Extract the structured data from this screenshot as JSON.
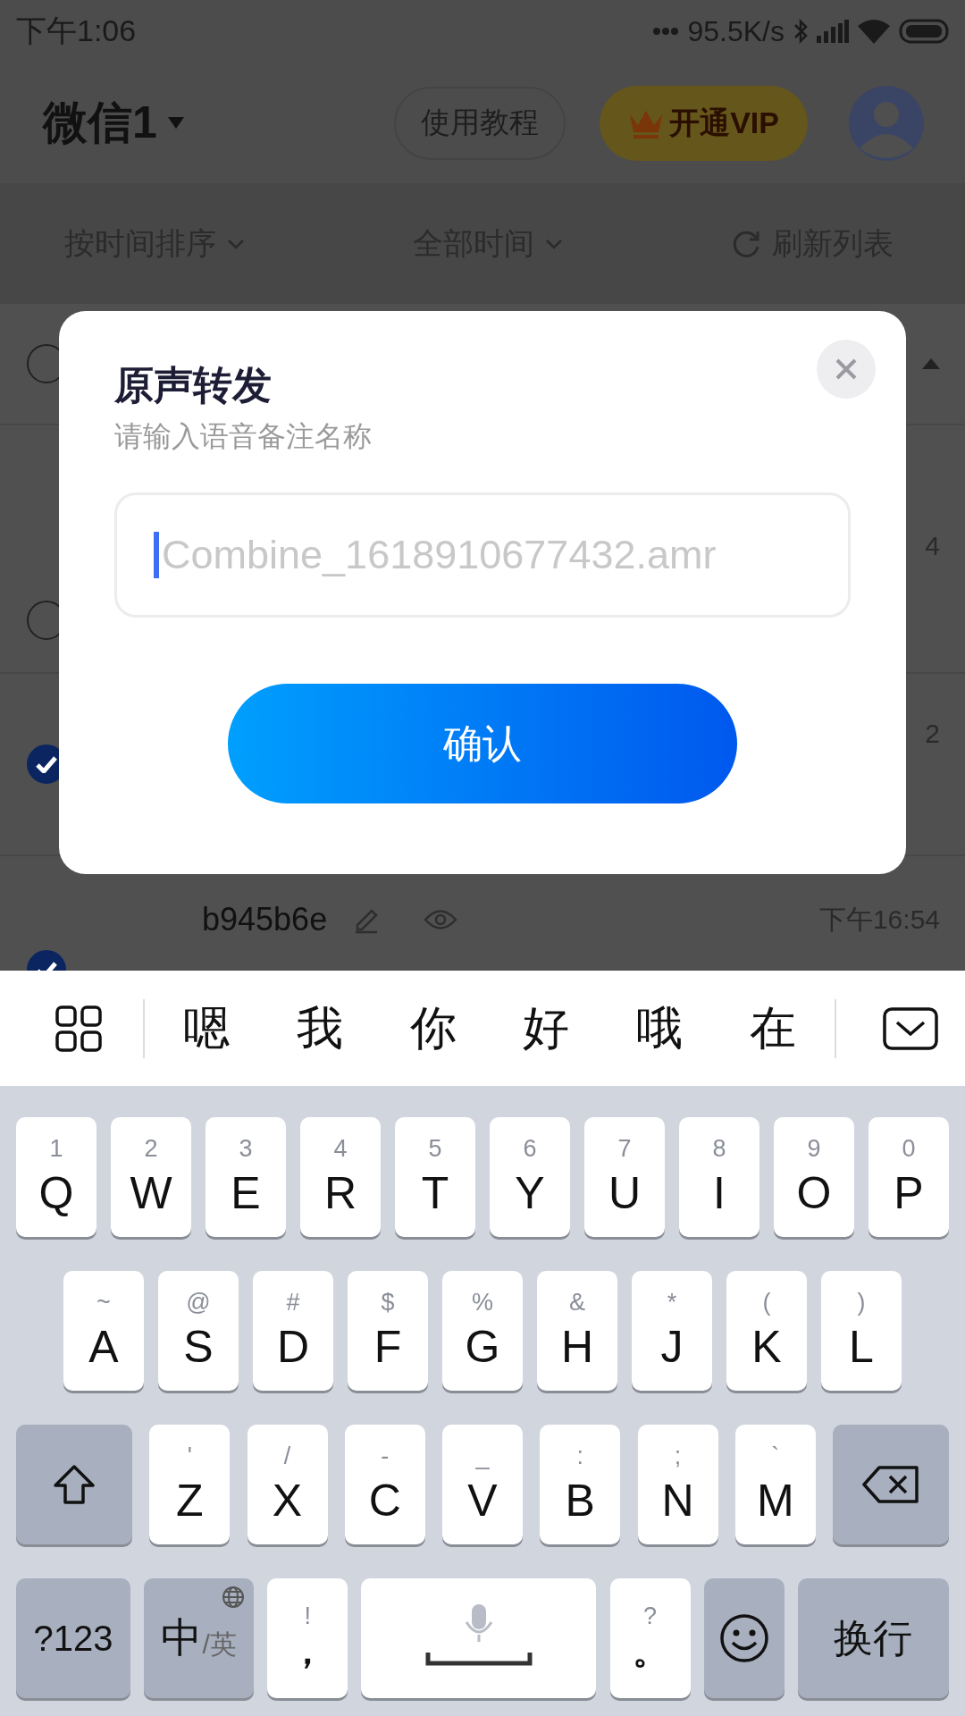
{
  "status_bar": {
    "time": "下午1:06",
    "network_speed": "95.5K/s"
  },
  "header": {
    "account": "微信1",
    "tutorial_button": "使用教程",
    "vip_button": "开通VIP"
  },
  "filters": [
    {
      "label": "按时间排序",
      "kind": "dropdown"
    },
    {
      "label": "全部时间",
      "kind": "dropdown"
    },
    {
      "label": "刷新列表",
      "kind": "refresh"
    }
  ],
  "list": [
    {
      "checked": false,
      "expanded": true
    },
    {
      "checked": false,
      "time": "4"
    },
    {
      "checked": true,
      "time": "2"
    },
    {
      "checked": true,
      "name": "b945b6e",
      "time": "下午16:54"
    }
  ],
  "dialog": {
    "title": "原声转发",
    "subtitle": "请输入语音备注名称",
    "input_placeholder": "Combine_1618910677432.amr",
    "confirm_button": "确认"
  },
  "candidates": [
    "嗯",
    "我",
    "你",
    "好",
    "哦",
    "在"
  ],
  "keyboard": [
    [
      {
        "kind": "letter",
        "label": "Q",
        "hint": "1"
      },
      {
        "kind": "letter",
        "label": "W",
        "hint": "2"
      },
      {
        "kind": "letter",
        "label": "E",
        "hint": "3"
      },
      {
        "kind": "letter",
        "label": "R",
        "hint": "4"
      },
      {
        "kind": "letter",
        "label": "T",
        "hint": "5"
      },
      {
        "kind": "letter",
        "label": "Y",
        "hint": "6"
      },
      {
        "kind": "letter",
        "label": "U",
        "hint": "7"
      },
      {
        "kind": "letter",
        "label": "I",
        "hint": "8"
      },
      {
        "kind": "letter",
        "label": "O",
        "hint": "9"
      },
      {
        "kind": "letter",
        "label": "P",
        "hint": "0"
      }
    ],
    [
      {
        "kind": "letter",
        "label": "A",
        "hint": "~"
      },
      {
        "kind": "letter",
        "label": "S",
        "hint": "@"
      },
      {
        "kind": "letter",
        "label": "D",
        "hint": "#"
      },
      {
        "kind": "letter",
        "label": "F",
        "hint": "$"
      },
      {
        "kind": "letter",
        "label": "G",
        "hint": "%"
      },
      {
        "kind": "letter",
        "label": "H",
        "hint": "&"
      },
      {
        "kind": "letter",
        "label": "J",
        "hint": "*"
      },
      {
        "kind": "letter",
        "label": "K",
        "hint": "("
      },
      {
        "kind": "letter",
        "label": "L",
        "hint": ")"
      }
    ],
    [
      {
        "kind": "shift"
      },
      {
        "kind": "letter",
        "label": "Z",
        "hint": "'"
      },
      {
        "kind": "letter",
        "label": "X",
        "hint": "/"
      },
      {
        "kind": "letter",
        "label": "C",
        "hint": "-"
      },
      {
        "kind": "letter",
        "label": "V",
        "hint": "_"
      },
      {
        "kind": "letter",
        "label": "B",
        "hint": ":"
      },
      {
        "kind": "letter",
        "label": "N",
        "hint": ";"
      },
      {
        "kind": "letter",
        "label": "M",
        "hint": "`"
      },
      {
        "kind": "backspace"
      }
    ],
    [
      {
        "kind": "symbols",
        "label": "?123"
      },
      {
        "kind": "language",
        "label": "中",
        "sublabel": "/英"
      },
      {
        "kind": "punct",
        "label": "，",
        "hint": "!"
      },
      {
        "kind": "space"
      },
      {
        "kind": "punct",
        "label": "。",
        "hint": "?"
      },
      {
        "kind": "emoji"
      },
      {
        "kind": "enter",
        "label": "换行"
      }
    ]
  ]
}
